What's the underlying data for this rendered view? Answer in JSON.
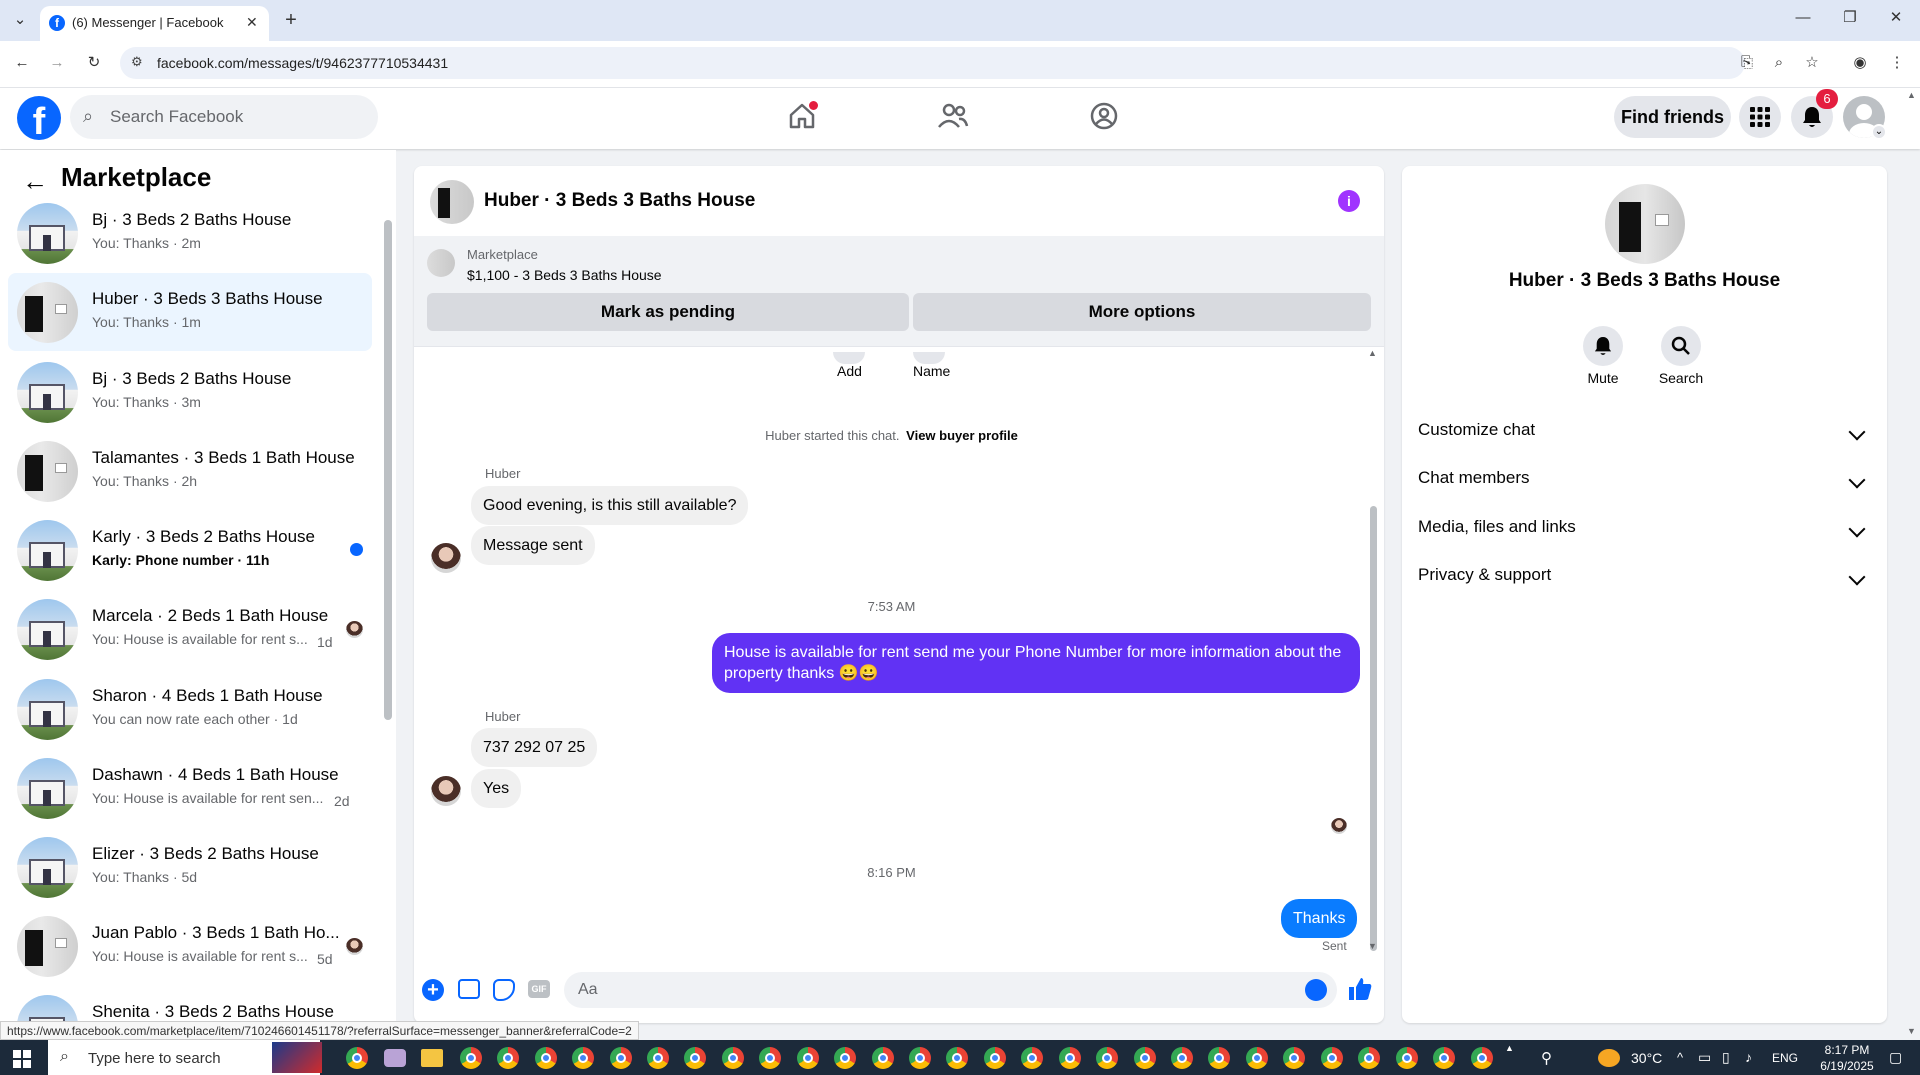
{
  "browser": {
    "tab_title": "(6) Messenger | Facebook",
    "url": "facebook.com/messages/t/9462377710534431",
    "status_url": "https://www.facebook.com/marketplace/item/710246601451178/?referralSurface=messenger_banner&referralCode=2"
  },
  "header": {
    "search_placeholder": "Search Facebook",
    "find_friends": "Find friends",
    "notifications_count": "6"
  },
  "sidebar": {
    "title": "Marketplace",
    "conversations": [
      {
        "name": "Bj · 3 Beds 2 Baths House",
        "sub": "You: Thanks · 2m"
      },
      {
        "name": "Huber · 3 Beds 3 Baths House",
        "sub": "You: Thanks · 1m"
      },
      {
        "name": "Bj · 3 Beds 2 Baths House",
        "sub": "You: Thanks · 3m"
      },
      {
        "name": "Talamantes · 3 Beds 1 Bath House",
        "sub": "You: Thanks · 2h"
      },
      {
        "name": "Karly · 3 Beds 2 Baths House",
        "sub": "Karly: Phone number · 11h"
      },
      {
        "name": "Marcela · 2 Beds 1 Bath House",
        "sub": "You: House is available for rent s...",
        "time": "1d"
      },
      {
        "name": "Sharon · 4 Beds 1 Bath House",
        "sub": "You can now rate each other · 1d"
      },
      {
        "name": "Dashawn · 4 Beds 1 Bath House",
        "sub": "You: House is available for rent sen...",
        "time": "2d"
      },
      {
        "name": "Elizer · 3 Beds 2 Baths House",
        "sub": "You: Thanks · 5d"
      },
      {
        "name": "Juan Pablo · 3 Beds 1 Bath Ho...",
        "sub": "You: House is available for rent s...",
        "time": "5d"
      },
      {
        "name": "Shenita · 3 Beds 2 Baths House",
        "sub": ""
      }
    ]
  },
  "chat": {
    "title": "Huber · 3 Beds 3 Baths House",
    "banner_label": "Marketplace",
    "banner_item": "$1,100 - 3 Beds 3 Baths House",
    "mark_pending": "Mark as pending",
    "more_options": "More options",
    "add_label": "Add",
    "name_label": "Name",
    "started_text": "Huber started this chat.",
    "view_profile": "View buyer profile",
    "sender_name": "Huber",
    "msg1": "Good evening, is this still available?",
    "msg2": "Message sent",
    "time1": "7:53 AM",
    "msg_out1": "House is available for rent send me your Phone Number for more information about the property thanks 😀😀",
    "msg3": "737 292 07 25",
    "msg4": "Yes",
    "time2": "8:16 PM",
    "msg_out2": "Thanks",
    "sent_status": "Sent",
    "composer_placeholder": "Aa",
    "gif_label": "GIF"
  },
  "details": {
    "name": "Huber · 3 Beds 3 Baths House",
    "mute": "Mute",
    "search": "Search",
    "sections": [
      "Customize chat",
      "Chat members",
      "Media, files and links",
      "Privacy & support"
    ]
  },
  "taskbar": {
    "search_placeholder": "Type here to search",
    "temperature": "30°C",
    "language": "ENG",
    "time": "8:17 PM",
    "date": "6/19/2025"
  },
  "colors": {
    "accent": "#6132f4",
    "fb_blue": "#0866ff",
    "notification_red": "#e41e3f"
  }
}
